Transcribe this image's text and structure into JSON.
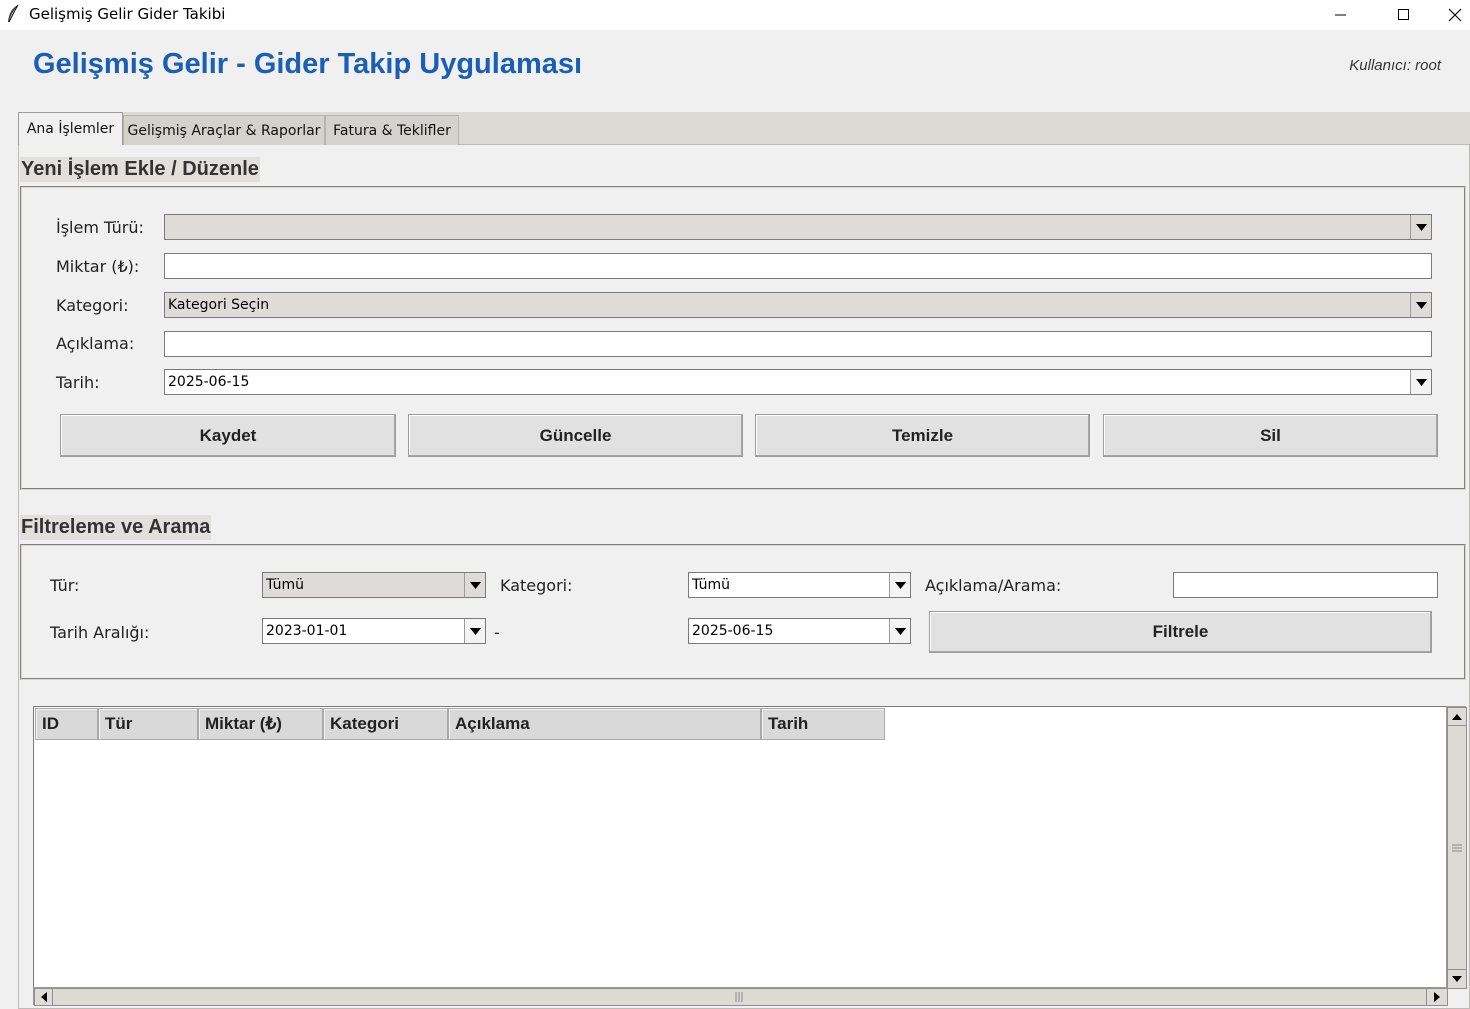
{
  "window": {
    "title": "Gelişmiş Gelir Gider Takibi"
  },
  "header": {
    "title": "Gelişmiş Gelir - Gider Takip Uygulaması",
    "user": "Kullanıcı: root",
    "title_color": "#1a5fb4"
  },
  "tabs": [
    {
      "label": "Ana İşlemler",
      "active": true
    },
    {
      "label": "Gelişmiş Araçlar & Raporlar",
      "active": false
    },
    {
      "label": "Fatura & Teklifler",
      "active": false
    }
  ],
  "form": {
    "section_title": "Yeni İşlem Ekle / Düzenle",
    "type_label": "İşlem Türü:",
    "type_value": "",
    "amount_label": "Miktar (₺):",
    "amount_value": "",
    "category_label": "Kategori:",
    "category_value": "Kategori Seçin",
    "description_label": "Açıklama:",
    "description_value": "",
    "date_label": "Tarih:",
    "date_value": "2025-06-15",
    "buttons": {
      "save": "Kaydet",
      "update": "Güncelle",
      "clear": "Temizle",
      "delete": "Sil"
    }
  },
  "filter": {
    "section_title": "Filtreleme ve Arama",
    "type_label": "Tür:",
    "type_value": "Tümü",
    "category_label": "Kategori:",
    "category_value": "Tümü",
    "search_label": "Açıklama/Arama:",
    "search_value": "",
    "date_range_label": "Tarih Aralığı:",
    "date_from": "2023-01-01",
    "date_separator": "-",
    "date_to": "2025-06-15",
    "filter_button": "Filtrele"
  },
  "table": {
    "columns": [
      "ID",
      "Tür",
      "Miktar (₺)",
      "Kategori",
      "Açıklama",
      "Tarih"
    ],
    "rows": []
  }
}
